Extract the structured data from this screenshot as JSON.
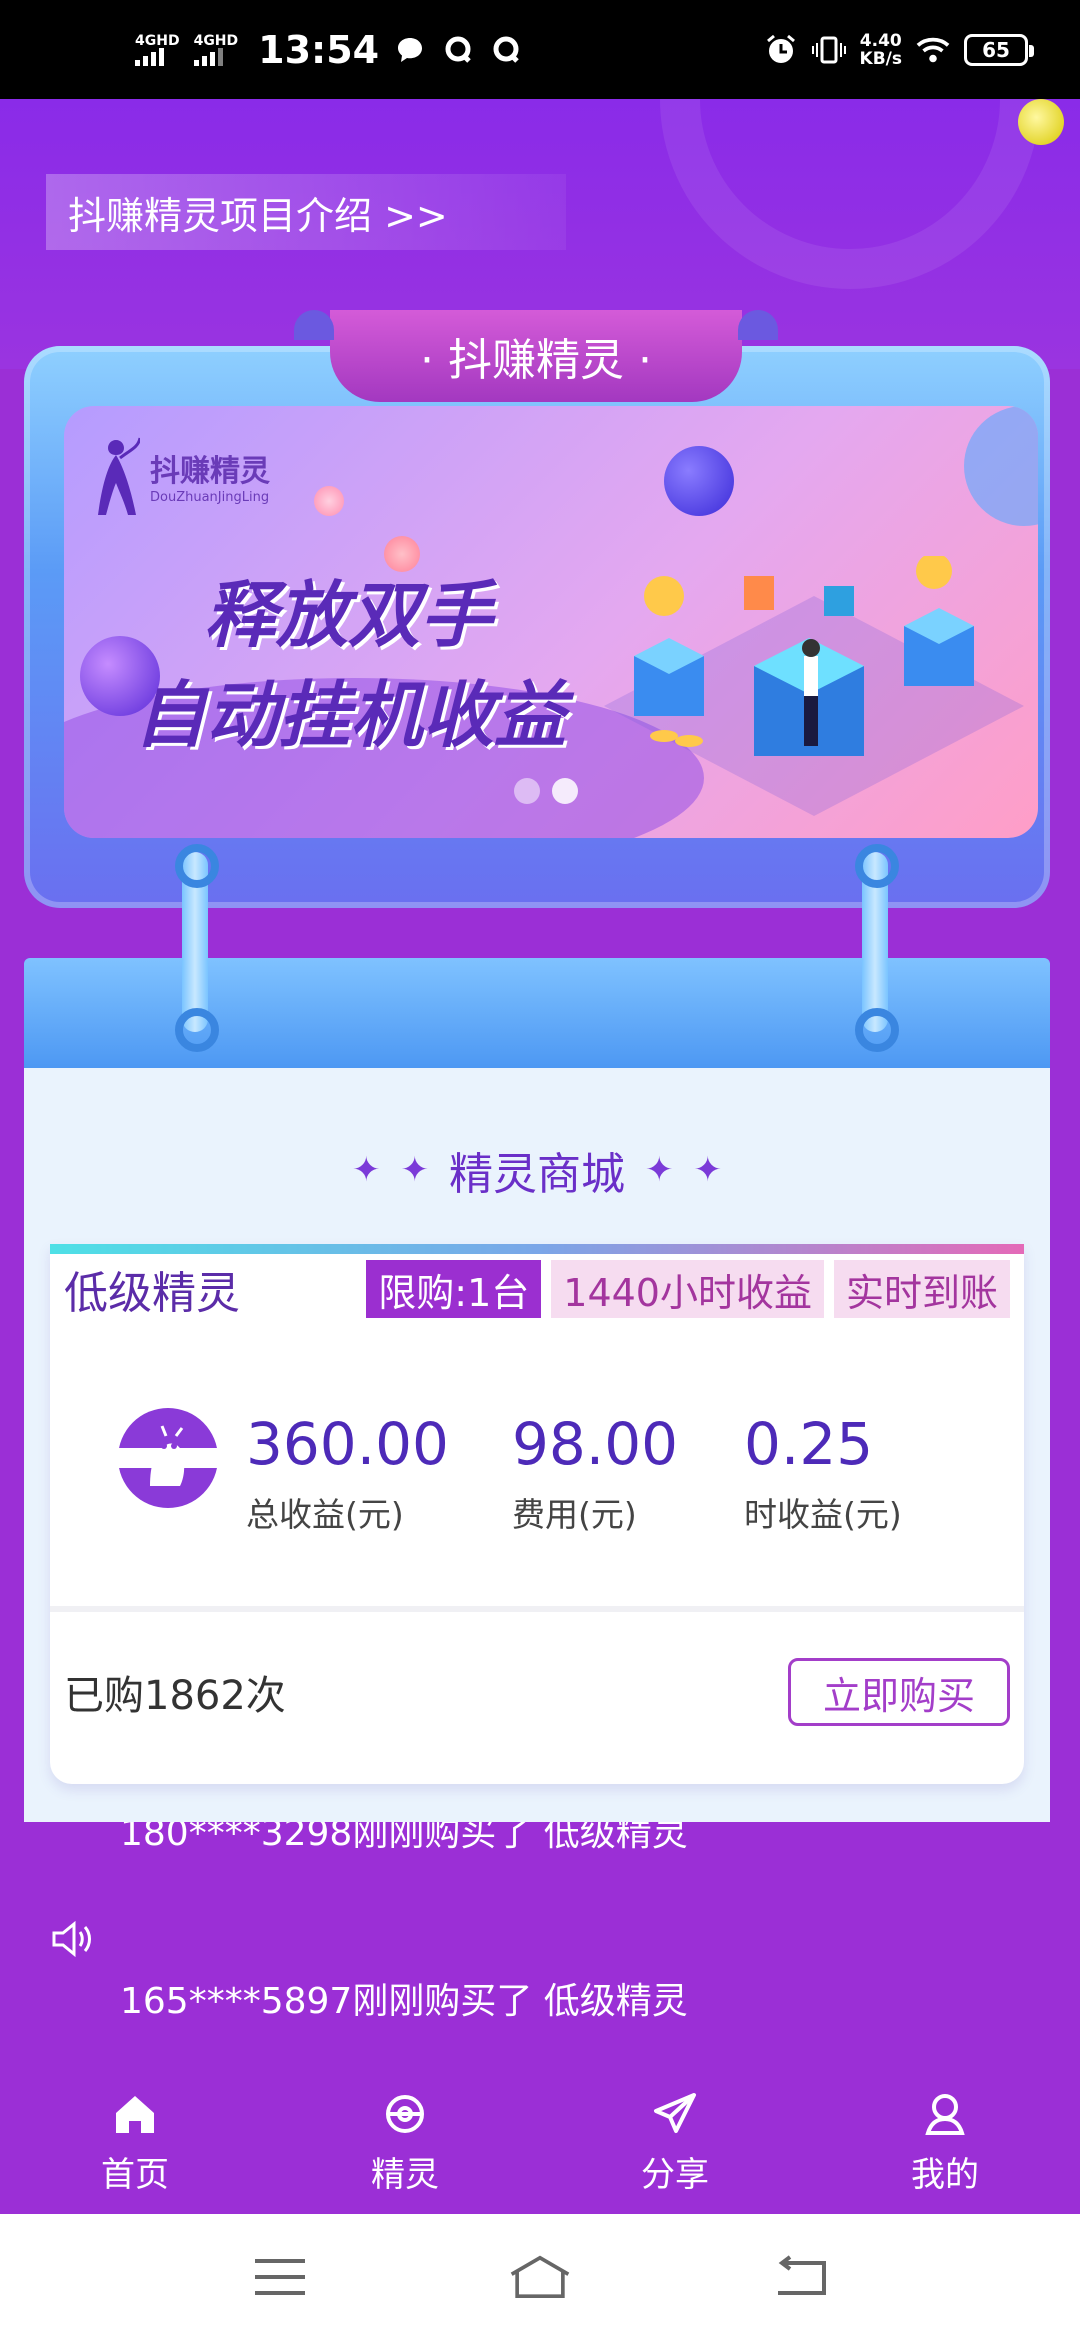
{
  "status_bar": {
    "network1": "4GHD",
    "network2": "4GHD",
    "time": "13:54",
    "speed_value": "4.40",
    "speed_unit": "KB/s",
    "battery": "65"
  },
  "header": {
    "intro_link": "抖赚精灵项目介绍 >>"
  },
  "board": {
    "tab_label": "· 抖赚精灵 ·",
    "banner": {
      "logo_name": "抖赚精灵",
      "logo_pinyin": "DouZhuanJingLing",
      "slogan_line1": "释放双手",
      "slogan_line2": "自动挂机收益",
      "page_count": 2,
      "active_page": 1
    }
  },
  "shop": {
    "title": "精灵商城",
    "product": {
      "name": "低级精灵",
      "tags": [
        "限购:1台",
        "1440小时收益",
        "实时到账"
      ],
      "stats": [
        {
          "value": "360.00",
          "label": "总收益(元)"
        },
        {
          "value": "98.00",
          "label": "费用(元)"
        },
        {
          "value": "0.25",
          "label": "时收益(元)"
        }
      ],
      "purchased": "已购1862次",
      "buy_label": "立即购买"
    }
  },
  "ticker": {
    "line1": "180****3298刚刚购买了 低级精灵",
    "line2": "165****5897刚刚购买了 低级精灵"
  },
  "tabbar": {
    "items": [
      {
        "label": "首页",
        "icon": "home-icon"
      },
      {
        "label": "精灵",
        "icon": "sprite-icon"
      },
      {
        "label": "分享",
        "icon": "share-icon"
      },
      {
        "label": "我的",
        "icon": "profile-icon"
      }
    ]
  },
  "colors": {
    "primary": "#9b2fd6",
    "accent_text": "#4d2ab8",
    "buy_border": "#a33ec9"
  }
}
